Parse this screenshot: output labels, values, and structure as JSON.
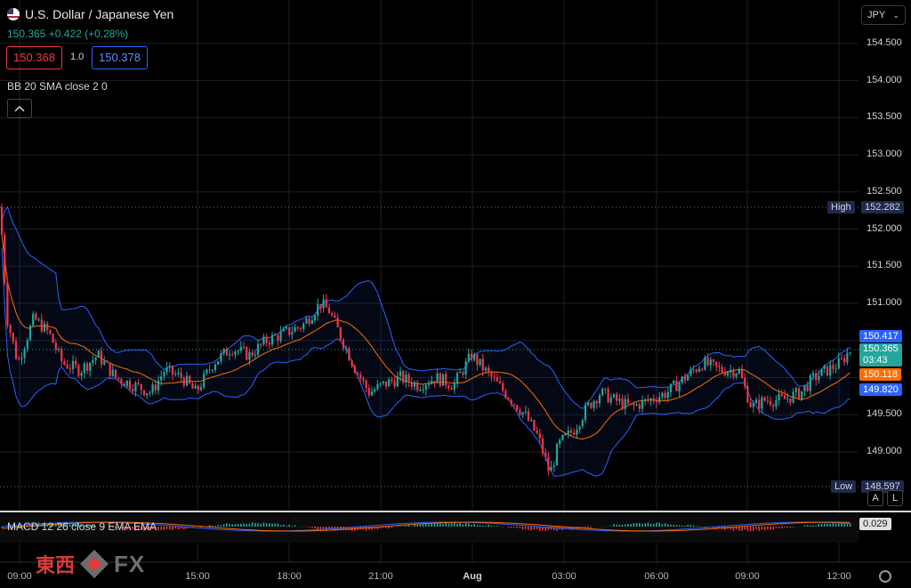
{
  "header": {
    "title": "U.S. Dollar / Japanese Yen",
    "price": "150.365",
    "change": "+0.422",
    "change_pct": "(+0.28%)",
    "bid": "150.368",
    "spread": "1.0",
    "ask": "150.378",
    "indicator_bb": "BB 20 SMA close 2 0",
    "indicator_macd": "MACD 12 26 close 9 EMA EMA"
  },
  "currency_selector": {
    "label": "JPY",
    "icon": "chevron-down-icon"
  },
  "price_axis": {
    "ticks": [
      "154.500",
      "154.000",
      "153.500",
      "153.000",
      "152.500",
      "152.000",
      "151.500",
      "151.000",
      "150.500",
      "150.000",
      "149.500",
      "149.000"
    ],
    "high_label": "High",
    "high_value": "152.282",
    "low_label": "Low",
    "low_value": "148.597",
    "bb_upper": "150.417",
    "last_price": "150.365",
    "countdown": "03:43",
    "bb_basis": "150.118",
    "bb_lower": "149.820",
    "macd_value": "0.029"
  },
  "time_axis": [
    "09:00",
    "15:00",
    "18:00",
    "21:00",
    "Aug",
    "03:00",
    "06:00",
    "09:00",
    "12:00"
  ],
  "buttons": {
    "auto": "A",
    "log": "L"
  },
  "logo": {
    "cn": "東西",
    "fx": "FX"
  },
  "colors": {
    "up": "#26a69a",
    "down": "#f23645",
    "bb_band": "#2962ff",
    "basis": "#ff6d00"
  },
  "chart_data": {
    "type": "candlestick",
    "title": "U.S. Dollar / Japanese Yen",
    "ylim": [
      148.5,
      154.75
    ],
    "high": 152.282,
    "low": 148.597,
    "close_path": [
      [
        0,
        152.3
      ],
      [
        8,
        150.8
      ],
      [
        20,
        150.2
      ],
      [
        38,
        150.8
      ],
      [
        55,
        150.6
      ],
      [
        70,
        150.2
      ],
      [
        90,
        150.1
      ],
      [
        110,
        150.3
      ],
      [
        130,
        150.0
      ],
      [
        150,
        149.9
      ],
      [
        170,
        149.8
      ],
      [
        185,
        150.1
      ],
      [
        205,
        150.0
      ],
      [
        220,
        149.8
      ],
      [
        240,
        150.2
      ],
      [
        260,
        150.4
      ],
      [
        280,
        150.3
      ],
      [
        300,
        150.5
      ],
      [
        320,
        150.6
      ],
      [
        340,
        150.7
      ],
      [
        360,
        151.0
      ],
      [
        370,
        150.9
      ],
      [
        385,
        150.5
      ],
      [
        400,
        150.1
      ],
      [
        415,
        149.8
      ],
      [
        430,
        149.9
      ],
      [
        450,
        150.0
      ],
      [
        470,
        149.9
      ],
      [
        490,
        150.0
      ],
      [
        510,
        149.9
      ],
      [
        530,
        150.3
      ],
      [
        545,
        150.1
      ],
      [
        560,
        149.9
      ],
      [
        575,
        149.7
      ],
      [
        590,
        149.5
      ],
      [
        605,
        149.2
      ],
      [
        618,
        148.7
      ],
      [
        628,
        149.1
      ],
      [
        645,
        149.3
      ],
      [
        660,
        149.6
      ],
      [
        675,
        149.8
      ],
      [
        690,
        149.7
      ],
      [
        710,
        149.6
      ],
      [
        730,
        149.7
      ],
      [
        750,
        149.8
      ],
      [
        770,
        150.0
      ],
      [
        790,
        150.2
      ],
      [
        810,
        150.1
      ],
      [
        830,
        150.1
      ],
      [
        845,
        149.6
      ],
      [
        860,
        149.7
      ],
      [
        880,
        149.7
      ],
      [
        900,
        149.8
      ],
      [
        915,
        150.0
      ],
      [
        930,
        150.1
      ],
      [
        945,
        150.2
      ],
      [
        955,
        150.365
      ]
    ],
    "bb_upper": 150.417,
    "bb_basis": 150.118,
    "bb_lower": 149.82,
    "macd": 0.029
  }
}
